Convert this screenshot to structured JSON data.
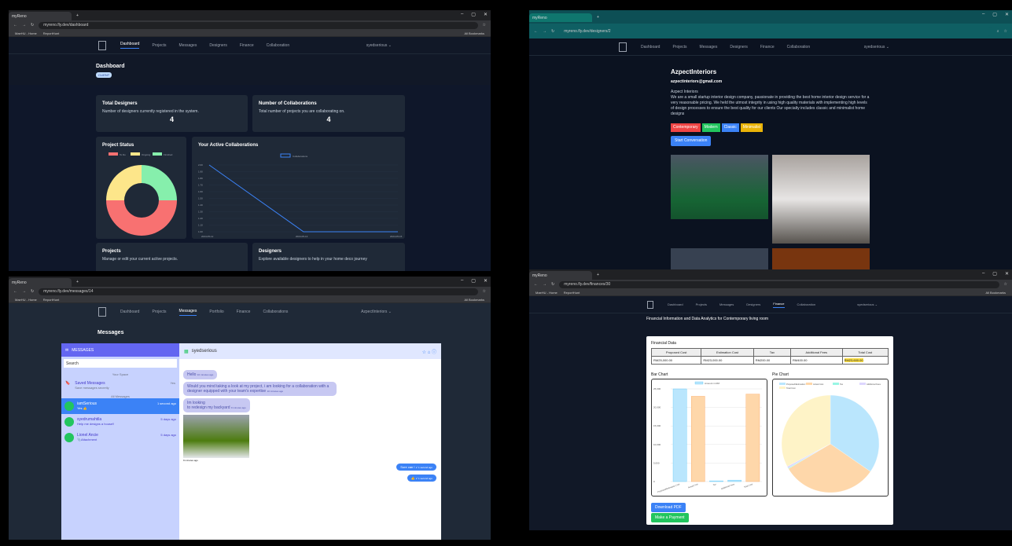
{
  "browser": {
    "tab_title": "myReno",
    "bookmarks": [
      "MaeHU - Home",
      "ReportHunt"
    ],
    "all_bookmarks": "All Bookmarks"
  },
  "w1": {
    "url": "myreno.fly.dev/dashboard",
    "nav": [
      "Dashboard",
      "Projects",
      "Messages",
      "Designers",
      "Finance",
      "Collaboration"
    ],
    "user": "syedserious ⌄",
    "title": "Dashboard",
    "badge": "CLIENT",
    "card1_title": "Total Designers",
    "card1_sub": "Number of designers currently registered in the system.",
    "card1_val": "4",
    "card2_title": "Number of Collaborations",
    "card2_sub": "Total number of projects you are collaborating on.",
    "card2_val": "4",
    "status_title": "Project Status",
    "status_legend": [
      "To Do",
      "Ongoing",
      "Finished"
    ],
    "status_colors": [
      "#f87171",
      "#fde68a",
      "#86efac"
    ],
    "collab_title": "Your Active Collaborations",
    "collab_legend": "Collaborations",
    "projects_title": "Projects",
    "projects_sub": "Manage or edit your current active projects.",
    "designers_title": "Designers",
    "designers_sub": "Explore available designers to help in your home deco journey"
  },
  "chart_data": [
    {
      "type": "pie",
      "title": "Project Status",
      "labels": [
        "To Do",
        "Ongoing",
        "Finished"
      ],
      "values": [
        2,
        1,
        1
      ]
    },
    {
      "type": "line",
      "title": "Your Active Collaborations",
      "x": [
        "2024-05-12",
        "2024-05-13",
        "2024-05-15"
      ],
      "series": [
        {
          "name": "Collaborations",
          "values": [
            2,
            1,
            1
          ]
        }
      ],
      "ylim": [
        1,
        2
      ],
      "yticks": [
        "2.00",
        "1.90",
        "1.80",
        "1.70",
        "1.60",
        "1.50",
        "1.40",
        "1.30",
        "1.20",
        "1.10",
        "1.00"
      ]
    },
    {
      "type": "bar",
      "title": "Bar Chart",
      "categories": [
        "Proposed/Estimation Cost",
        "Actual Cost",
        "Tax",
        "Additional Fees",
        "Total Cost"
      ],
      "series": [
        {
          "name": "Amount in RM",
          "values": [
            25000,
            23000,
            200,
            400,
            23600
          ]
        }
      ],
      "ylim": [
        0,
        25000
      ],
      "yticks": [
        "25,000",
        "20,000",
        "15,000",
        "10,000",
        "5,000",
        "0"
      ]
    },
    {
      "type": "pie",
      "title": "Pie Chart",
      "labels": [
        "Proposed/Estimation Cost",
        "Actual Cost",
        "Tax",
        "Additional Fees",
        "Total Cost"
      ],
      "values": [
        25000,
        23000,
        200,
        400,
        23600
      ]
    }
  ],
  "w2": {
    "url": "myreno.fly.dev/designers/2",
    "nav": [
      "Dashboard",
      "Projects",
      "Messages",
      "Designers",
      "Finance",
      "Collaboration"
    ],
    "user": "syedserious ⌄",
    "name": "AzpectInteriors",
    "email": "azpectinteriors@gmail.com",
    "about_title": "Azpect Interiors",
    "about": "We are a small startup interior design company, passionate in providing the best home interior design service for a very reasonable pricing. We held the utmost integrity in using high quality materials with implementing high levels of design processes to ensure the best quality for our clients Our specialty includes classic and minimalist home designs",
    "tags": [
      "Contemporary",
      "Modern",
      "Classic",
      "Minimalist"
    ],
    "tag_colors": [
      "#ef4444",
      "#22c55e",
      "#3b82f6",
      "#eab308"
    ],
    "start": "Start Conversation"
  },
  "w3": {
    "url": "myreno.fly.dev/messages/14",
    "nav": [
      "Dashboard",
      "Projects",
      "Messages",
      "Portfolio",
      "Finance",
      "Collaborations"
    ],
    "user": "AzpectInteriors ⌄",
    "title": "Messages",
    "panel": "MESSAGES",
    "search": "Search",
    "your_space": "Your Space",
    "saved": "Saved Messages",
    "saved_sub": "Save messages secretly",
    "saved_time": "Yes",
    "all_messages": "All Messages",
    "contacts": [
      {
        "name": "iamSerious",
        "sub": "Yes 👍",
        "time": "1 second ago"
      },
      {
        "name": "syedrumahtila",
        "sub": "Help me designs a house!!",
        "time": "5 days ago"
      },
      {
        "name": "Lionel Ancie",
        "sub": "📎Attachment",
        "time": "5 days ago"
      }
    ],
    "chat_user": "syedserious",
    "m1": "Hello",
    "m1t": "10 minutes ago",
    "m2": "Would you mind taking a look at my project, i am looking for a collaboration with a designer equipped with your team's expertise",
    "m2t": "10 minutes ago",
    "m3a": "Im looking",
    "m3b": "to redesign my backyard",
    "m3t": "9 minutes ago",
    "img_t": "9 minutes ago",
    "r1": "Sure can !",
    "r1t": "✔ 1 second ago",
    "r2": "👍",
    "r2t": "✔ 1 second ago"
  },
  "w4": {
    "url": "myreno.fly.dev/finances/30",
    "nav": [
      "Dashboard",
      "Projects",
      "Messages",
      "Designers",
      "Finance",
      "Collaboration"
    ],
    "user": "syedserious ⌄",
    "heading": "Financial Information and Data Analytics for Contemporary living room",
    "fin_title": "Financial Data",
    "headers": [
      "Proposed Cost",
      "Estimation Cost",
      "Tax",
      "Additional Fees",
      "Total Cost"
    ],
    "row": [
      "RM25,000.00",
      "RM23,000.00",
      "RM200.00",
      "RM400.00",
      "RM23,600.00"
    ],
    "bar_title": "Bar Chart",
    "bar_legend": "Amount in RM",
    "pie_title": "Pie Chart",
    "pie_legend": [
      "Proposed/Estimation Cost",
      "Actual Cost",
      "Tax",
      "Additional Fees",
      "Total Cost"
    ],
    "download": "Download PDF",
    "pay": "Make a Payment"
  }
}
